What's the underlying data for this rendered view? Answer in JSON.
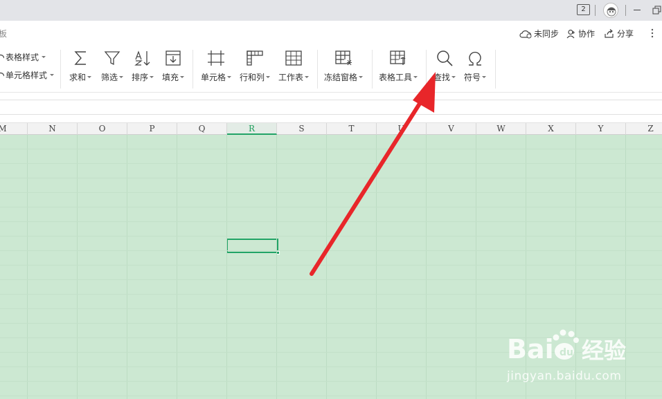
{
  "titlebar": {
    "badge_text": "2",
    "colors": {
      "bg": "#e3e4e8"
    }
  },
  "tabrow": {
    "partial_tab": "板",
    "sync_label": "未同步",
    "collab_label": "协作",
    "share_label": "分享"
  },
  "ribbon": {
    "table_style_label": "表格样式",
    "cell_style_label": "单元格样式",
    "buttons": {
      "sum": "求和",
      "filter": "筛选",
      "sort": "排序",
      "fill": "填充",
      "cell": "单元格",
      "rowcol": "行和列",
      "sheet": "工作表",
      "freeze": "冻结窗格",
      "tabletools": "表格工具",
      "find": "查找",
      "symbol": "符号"
    }
  },
  "sheet": {
    "columns": [
      "M",
      "N",
      "O",
      "P",
      "Q",
      "R",
      "S",
      "T",
      "U",
      "V",
      "W",
      "X",
      "Y",
      "Z"
    ],
    "active_column": "R",
    "colors": {
      "grid_bg": "#cce8d2",
      "accent": "#21a366"
    }
  },
  "annotation": {
    "arrow_color": "#e8262a"
  },
  "watermark": {
    "logo_text": "Bai经验",
    "url": "jingyan.baidu.com"
  }
}
